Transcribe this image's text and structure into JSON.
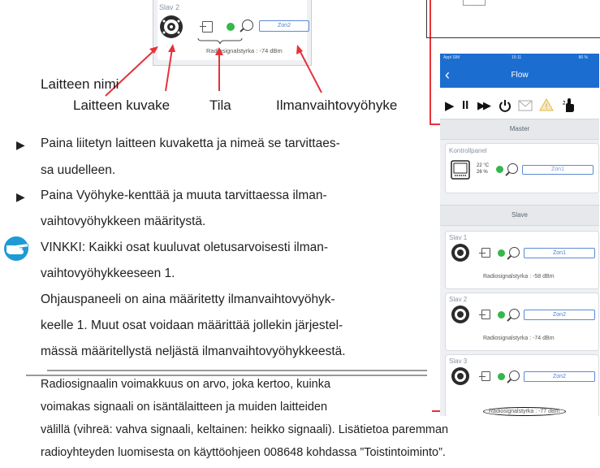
{
  "top_panel": {
    "slav_name": "Slav 2",
    "zone": "Zon2",
    "radio_text": "Radiosignalstyrka : -74 dBm"
  },
  "labels": {
    "device_name": "Laitteen nimi",
    "device_icon": "Laitteen kuvake",
    "status": "Tila",
    "ventilation_zone": "Ilmanvaihtovyöhyke"
  },
  "instructions": {
    "bullet1_l1": "Paina liitetyn laitteen kuvaketta ja nimeä se tarvittaes-",
    "bullet1_l2": "sa uudelleen.",
    "bullet2_l1": "Paina Vyöhyke-kenttää ja muuta tarvittaessa ilman-",
    "bullet2_l2": "vaihtovyöhykkeen määritystä.",
    "tip_l1": "VINKKI: Kaikki osat kuuluvat oletusarvoisesti ilman-",
    "tip_l2": "vaihtovyöhykkeeseen 1.",
    "tip_l3": "Ohjauspaneeli on aina määritetty ilmanvaihtovyöhyk-",
    "tip_l4": "keelle 1. Muut osat voidaan määrittää jollekin järjestel-",
    "tip_l5": "mässä määritellystä neljästä ilmanvaihtovyöhykkeestä.",
    "radio_l1": "Radiosignaalin voimakkuus on arvo, joka kertoo, kuinka",
    "radio_l2": "voimakas signaali on isäntälaitteen ja muiden laitteiden",
    "radio_l3": "välillä (vihreä: vahva signaali, keltainen: heikko signaali). Lisätietoa paremman",
    "radio_l4": "radioyhteyden luomisesta on käyttöohjeen 008648 kohdassa ”Toistintoiminto”."
  },
  "phone": {
    "status_left": "Appl SIM",
    "status_time": "15:11",
    "status_right": "86 %",
    "title": "Flow",
    "master_header": "Master",
    "master_card": {
      "name": "Kontrollpanel",
      "temp": "22 °C",
      "humidity": "26 %",
      "zone": "Zon1"
    },
    "slave_header": "Slave",
    "slaves": [
      {
        "name": "Slav 1",
        "zone": "Zon1",
        "radio": "Radiosignalstyrka : -58 dBm"
      },
      {
        "name": "Slav 2",
        "zone": "Zon2",
        "radio": "Radiosignalstyrka : -74 dBm"
      },
      {
        "name": "Slav 3",
        "zone": "Zon2",
        "radio": "Radiosignalstyrka : -77 dBm"
      }
    ]
  },
  "colors": {
    "accent_blue": "#1c6dd0",
    "arrow_red": "#e5323b",
    "status_green": "#33b84a",
    "tip_blue": "#1e9ad6"
  }
}
